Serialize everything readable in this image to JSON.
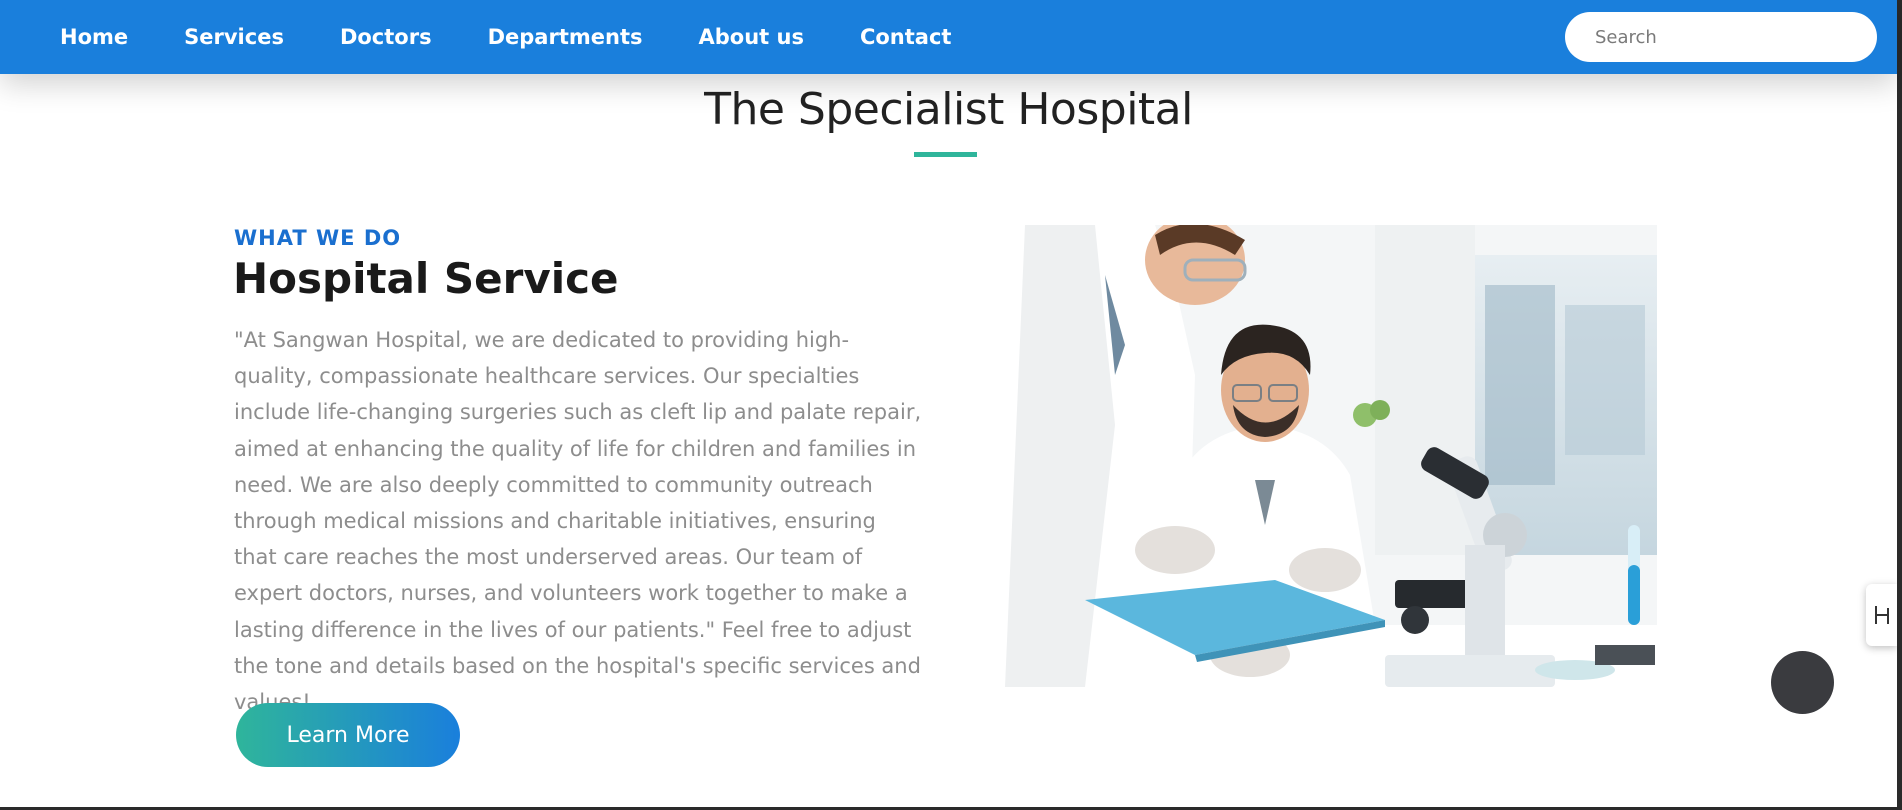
{
  "nav": {
    "items": [
      {
        "label": "Home"
      },
      {
        "label": "Services"
      },
      {
        "label": "Doctors"
      },
      {
        "label": "Departments"
      },
      {
        "label": "About us"
      },
      {
        "label": "Contact"
      }
    ],
    "search_placeholder": "Search"
  },
  "section": {
    "title": "The Specialist Hospital"
  },
  "service": {
    "eyebrow": "WHAT WE DO",
    "heading": "Hospital Service",
    "body": "\"At Sangwan Hospital, we are dedicated to providing high-quality, compassionate healthcare services. Our specialties include life-changing surgeries such as cleft lip and palate repair, aimed at enhancing the quality of life for children and families in need. We are also deeply committed to community outreach through medical missions and charitable initiatives, ensuring that care reaches the most underserved areas. Our team of expert doctors, nurses, and volunteers work together to make a lasting difference in the lives of our patients.\" Feel free to adjust the tone and details based on the hospital's specific services and values!",
    "button_label": "Learn More"
  },
  "colors": {
    "nav_bg": "#1a7fdc",
    "accent_teal": "#2fb59b",
    "eyebrow_blue": "#1a6fcf"
  }
}
